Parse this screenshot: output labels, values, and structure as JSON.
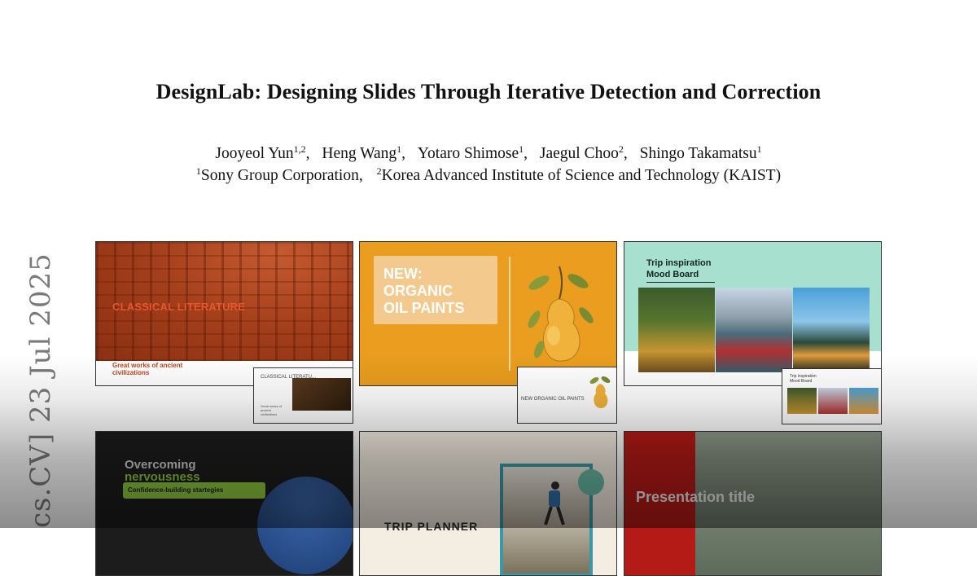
{
  "paper": {
    "title": "DesignLab: Designing Slides Through Iterative Detection and Correction",
    "authors": [
      {
        "name": "Jooyeol Yun",
        "sup": "1,2"
      },
      {
        "name": "Heng Wang",
        "sup": "1"
      },
      {
        "name": "Yotaro Shimose",
        "sup": "1"
      },
      {
        "name": "Jaegul Choo",
        "sup": "2"
      },
      {
        "name": "Shingo Takamatsu",
        "sup": "1"
      }
    ],
    "affiliations": [
      {
        "sup": "1",
        "name": "Sony Group Corporation,"
      },
      {
        "sup": "2",
        "name": "Korea Advanced Institute of Science and Technology (KAIST)"
      }
    ],
    "arxiv_stamp": "cs.CV]  23 Jul 2025"
  },
  "figure": {
    "slides": [
      {
        "title": "CLASSICAL LITERATURE",
        "subtitle": "Great works of ancient civilizations",
        "thumb_title": "CLASSICAL LITERATU...",
        "thumb_sub": "Great works of ancient civilizations"
      },
      {
        "title_lines": [
          "NEW:",
          "ORGANIC",
          "OIL PAINTS"
        ],
        "thumb_title": "NEW ORGANIC OIL PAINTS"
      },
      {
        "title_lines": [
          "Trip inspiration",
          "Mood Board"
        ],
        "thumb_title_lines": [
          "Trip inspiration",
          "Mood Board"
        ]
      },
      {
        "title_lines": [
          "Overcoming",
          "nervousness"
        ],
        "pill": "Confidence-building startegies"
      },
      {
        "title": "TRIP PLANNER"
      },
      {
        "title": "Presentation title"
      }
    ]
  },
  "colors": {
    "s1_red": "#a33e1a",
    "s2_orange": "#ea9d1e",
    "s3_mint": "#a7e0ce",
    "s4_green": "#8cc63e",
    "s6_red": "#b41a16"
  }
}
